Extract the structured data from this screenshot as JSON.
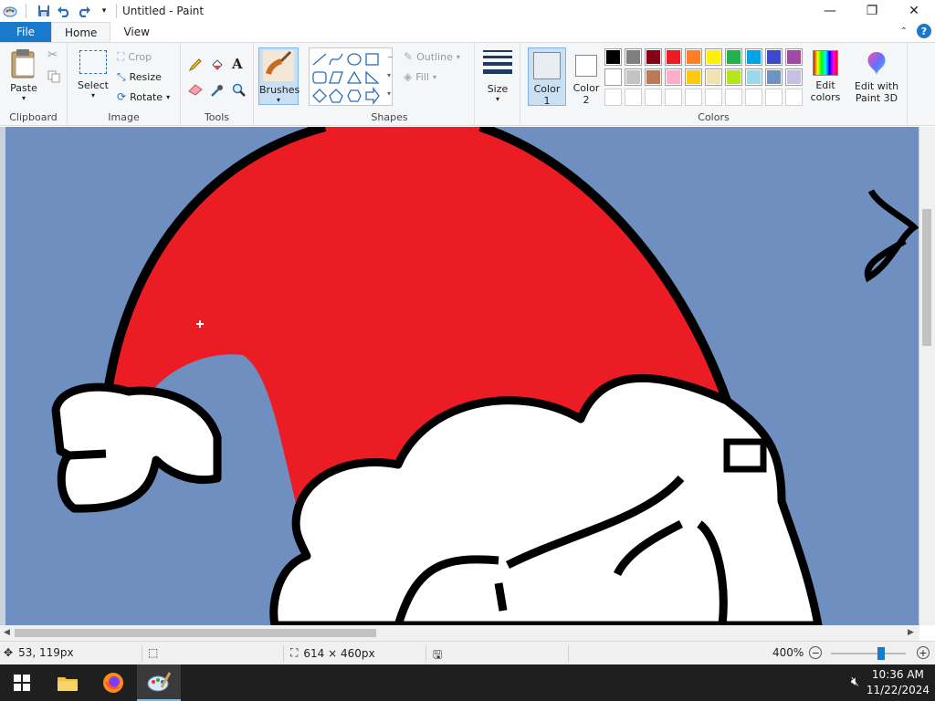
{
  "window": {
    "title": "Untitled - Paint"
  },
  "tabs": {
    "file": "File",
    "home": "Home",
    "view": "View"
  },
  "clipboard": {
    "paste": "Paste",
    "group": "Clipboard"
  },
  "image": {
    "select": "Select",
    "crop": "Crop",
    "resize": "Resize",
    "rotate": "Rotate",
    "group": "Image"
  },
  "tools": {
    "group": "Tools"
  },
  "brushes": {
    "label": "Brushes"
  },
  "shapes": {
    "outline": "Outline",
    "fill": "Fill",
    "group": "Shapes"
  },
  "size": {
    "label": "Size"
  },
  "colors": {
    "color1": "Color\n1",
    "color1_a": "Color",
    "color1_b": "1",
    "color2_a": "Color",
    "color2_b": "2",
    "edit": "Edit colors",
    "edit_a": "Edit",
    "edit_b": "colors",
    "group": "Colors",
    "row1": [
      "#000000",
      "#7f7f7f",
      "#880015",
      "#ed1c24",
      "#ff7f27",
      "#fff200",
      "#22b14c",
      "#00a2e8",
      "#3f48cc",
      "#a349a4"
    ],
    "row2": [
      "#ffffff",
      "#c3c3c3",
      "#b97a57",
      "#ffaec9",
      "#ffc90e",
      "#efe4b0",
      "#b5e61d",
      "#99d9ea",
      "#7092be",
      "#c8bfe7"
    ],
    "row3_empty": 10
  },
  "paint3d": {
    "a": "Edit with",
    "b": "Paint 3D"
  },
  "status": {
    "cursor": "53, 119px",
    "size": "614 × 460px",
    "zoom": "400%"
  },
  "taskbar": {
    "time": "10:36 AM",
    "date": "11/22/2024"
  }
}
